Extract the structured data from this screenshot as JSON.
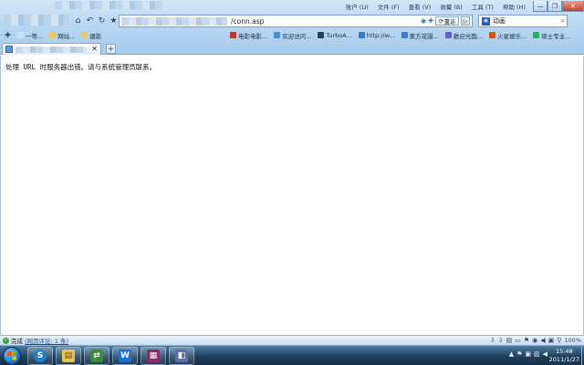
{
  "window": {
    "menu": [
      "账户 (U)",
      "文件 (F)",
      "查看 (V)",
      "收藏 (B)",
      "工具 (T)",
      "帮助 (H)"
    ],
    "buttons": [
      "—",
      "❐",
      "✕"
    ]
  },
  "address_bar": {
    "url_visible": "/conn.asp",
    "go_label": "重访"
  },
  "search": {
    "query": "动画"
  },
  "favorites": [
    {
      "label": "电影电影...",
      "color": "#c0392b"
    },
    {
      "label": "欢迎访问...",
      "color": "#4a90d9"
    },
    {
      "label": "TurboA...",
      "color": "#2c3e50"
    },
    {
      "label": "http://w...",
      "color": "#2f7dc4"
    },
    {
      "label": "東方花園...",
      "color": "#3a7bd5"
    },
    {
      "label": "歡迎光臨...",
      "color": "#6a5acd"
    },
    {
      "label": "火星娱乐...",
      "color": "#d35400"
    },
    {
      "label": "硕士专业...",
      "color": "#27ae60"
    }
  ],
  "left_favorites": [
    "一等...",
    "网站...",
    "摄影"
  ],
  "tab": {
    "close": "✕",
    "new": "+"
  },
  "page": {
    "error_message": "处理 URL 时服务器出错。请与系统管理员联系。"
  },
  "status_bar": {
    "status": "完成",
    "link": "(网页评论: 1 条)",
    "zoom": "100%"
  },
  "taskbar": {
    "time": "15:48",
    "date": "2011/1/27"
  }
}
